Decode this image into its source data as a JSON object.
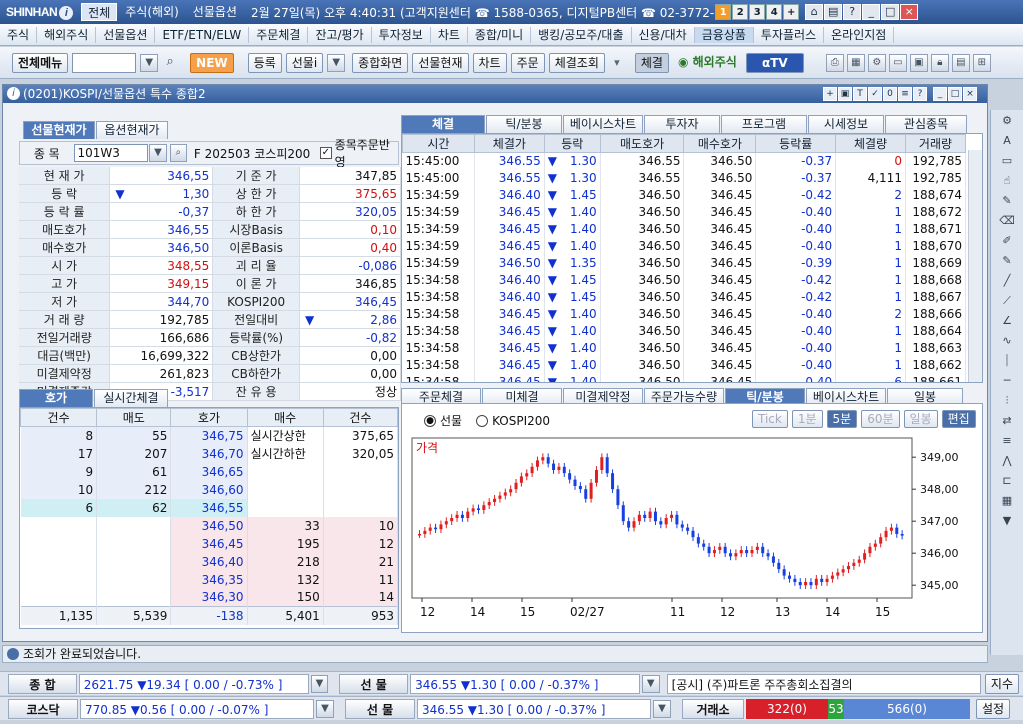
{
  "titlebar": {
    "logo": "SHINHAN",
    "tabs": [
      "전체",
      "주식(해외)",
      "선물옵션"
    ],
    "info": "2월 27일(목) 오후 4:40:31 (고객지원센터 ☎ 1588-0365, 디지털PB센터 ☎ 02-3772-",
    "nums": [
      "1",
      "2",
      "3",
      "4",
      "+"
    ]
  },
  "menu": [
    "주식",
    "해외주식",
    "선물옵션",
    "ETF/ETN/ELW",
    "주문체결",
    "잔고/평가",
    "투자정보",
    "차트",
    "종합/미니",
    "뱅킹/공모주/대출",
    "신용/대차",
    "금융상품",
    "투자플러스",
    "온라인지점"
  ],
  "toolbar": {
    "all_menu": "전체메뉴",
    "new": "NEW",
    "register": "등록",
    "futures_select": "선물i",
    "buttons": [
      "종합화면",
      "선물현재",
      "차트",
      "주문",
      "체결조회"
    ],
    "trade": "체결",
    "overseas": "해외주식",
    "tv": "TV"
  },
  "window": {
    "title": "(0201)KOSPI/선물옵션 특수 종합2",
    "title_btns": [
      "+",
      "□",
      "T",
      "?",
      "0",
      "≡",
      "?",
      "_",
      "□",
      "×"
    ]
  },
  "left_tabs": [
    "선물현재가",
    "옵션현재가"
  ],
  "symbol": {
    "label": "종  목",
    "code": "101W3",
    "name": "F 202503 코스피200",
    "checkbox": "종목주문반영"
  },
  "quote_rows": [
    {
      "l1": "현 재 가",
      "v1": "346,55",
      "c1": "blue",
      "l2": "기 준 가",
      "v2": "347,85",
      "c2": "blk"
    },
    {
      "l1": "등    락",
      "v1": "1,30",
      "c1": "blue",
      "arrow": "▼",
      "l2": "상 한 가",
      "v2": "375,65",
      "c2": "red"
    },
    {
      "l1": "등 락 률",
      "v1": "-0,37",
      "c1": "blue",
      "l2": "하 한 가",
      "v2": "320,05",
      "c2": "blue"
    },
    {
      "l1": "매도호가",
      "v1": "346,55",
      "c1": "blue",
      "l2": "시장Basis",
      "v2": "0,10",
      "c2": "red"
    },
    {
      "l1": "매수호가",
      "v1": "346,50",
      "c1": "blue",
      "l2": "이론Basis",
      "v2": "0,40",
      "c2": "red"
    },
    {
      "l1": "시    가",
      "v1": "348,55",
      "c1": "red",
      "l2": "괴 리 율",
      "v2": "-0,086",
      "c2": "blue"
    },
    {
      "l1": "고    가",
      "v1": "349,15",
      "c1": "red",
      "l2": "이 론 가",
      "v2": "346,85",
      "c2": "blk"
    },
    {
      "l1": "저    가",
      "v1": "344,70",
      "c1": "blue",
      "l2": "KOSPI200",
      "v2": "346,45",
      "c2": "blue"
    },
    {
      "l1": "거 래 량",
      "v1": "192,785",
      "c1": "blk",
      "l2": "전일대비",
      "v2": "2,86",
      "c2": "blue",
      "arrow2": "▼"
    },
    {
      "l1": "전일거래량",
      "v1": "166,686",
      "c1": "blk",
      "l2": "등락률(%)",
      "v2": "-0,82",
      "c2": "blue"
    },
    {
      "l1": "대금(백만)",
      "v1": "16,699,322",
      "c1": "blk",
      "l2": "CB상한가",
      "v2": "0,00",
      "c2": "blk"
    },
    {
      "l1": "미결제약정",
      "v1": "261,823",
      "c1": "blk",
      "l2": "CB하한가",
      "v2": "0,00",
      "c2": "blk"
    },
    {
      "l1": "미결제증감",
      "v1": "-3,517",
      "c1": "blue",
      "l2": "잔 유 용",
      "v2": "정상",
      "c2": "blk"
    }
  ],
  "trade_tabs": [
    "체결",
    "틱/분봉",
    "베이시스차트",
    "투자자",
    "프로그램",
    "시세정보",
    "관심종목"
  ],
  "trade_header": [
    "시간",
    "체결가",
    "등락",
    "매도호가",
    "매수호가",
    "등락률",
    "체결량",
    "거래량"
  ],
  "trades": [
    [
      "15:45:00",
      "346.55",
      "1.30",
      "346.55",
      "346.50",
      "-0.37",
      "0",
      "192,785"
    ],
    [
      "15:45:00",
      "346.55",
      "1.30",
      "346.55",
      "346.50",
      "-0.37",
      "4,111",
      "192,785"
    ],
    [
      "15:34:59",
      "346.40",
      "1.45",
      "346.50",
      "346.45",
      "-0.42",
      "2",
      "188,674"
    ],
    [
      "15:34:59",
      "346.45",
      "1.40",
      "346.50",
      "346.45",
      "-0.40",
      "1",
      "188,672"
    ],
    [
      "15:34:59",
      "346.45",
      "1.40",
      "346.50",
      "346.45",
      "-0.40",
      "1",
      "188,671"
    ],
    [
      "15:34:59",
      "346.45",
      "1.40",
      "346.50",
      "346.45",
      "-0.40",
      "1",
      "188,670"
    ],
    [
      "15:34:59",
      "346.50",
      "1.35",
      "346.50",
      "346.45",
      "-0.39",
      "1",
      "188,669"
    ],
    [
      "15:34:58",
      "346.40",
      "1.45",
      "346.50",
      "346.45",
      "-0.42",
      "1",
      "188,668"
    ],
    [
      "15:34:58",
      "346.40",
      "1.45",
      "346.50",
      "346.45",
      "-0.42",
      "1",
      "188,667"
    ],
    [
      "15:34:58",
      "346.45",
      "1.40",
      "346.50",
      "346.45",
      "-0.40",
      "2",
      "188,666"
    ],
    [
      "15:34:58",
      "346.45",
      "1.40",
      "346.50",
      "346.45",
      "-0.40",
      "1",
      "188,664"
    ],
    [
      "15:34:58",
      "346.45",
      "1.40",
      "346.50",
      "346.45",
      "-0.40",
      "1",
      "188,663"
    ],
    [
      "15:34:58",
      "346.45",
      "1.40",
      "346.50",
      "346.45",
      "-0.40",
      "1",
      "188,662"
    ],
    [
      "15:34:58",
      "346.45",
      "1.40",
      "346.50",
      "346.45",
      "-0.40",
      "6",
      "188,661"
    ]
  ],
  "ob_tabs": [
    "호가",
    "실시간체결"
  ],
  "ob_header": [
    "건수",
    "매도",
    "호가",
    "매수",
    "건수"
  ],
  "ob_asks": [
    [
      "8",
      "55",
      "346,75"
    ],
    [
      "17",
      "207",
      "346,70"
    ],
    [
      "9",
      "61",
      "346,65"
    ],
    [
      "10",
      "212",
      "346,60"
    ],
    [
      "6",
      "62",
      "346,55"
    ]
  ],
  "ob_bids": [
    [
      "346,50",
      "33",
      "10"
    ],
    [
      "346,45",
      "195",
      "12"
    ],
    [
      "346,40",
      "218",
      "21"
    ],
    [
      "346,35",
      "132",
      "11"
    ],
    [
      "346,30",
      "150",
      "14"
    ]
  ],
  "ob_side": [
    [
      "실시간상한",
      "375,65"
    ],
    [
      "실시간하한",
      "320,05"
    ]
  ],
  "ob_total": [
    "1,135",
    "5,539",
    "-138",
    "5,401",
    "953"
  ],
  "chart_tabs": [
    "주문체결",
    "미체결",
    "미결제약정",
    "주문가능수량",
    "틱/분봉",
    "베이시스차트",
    "일봉"
  ],
  "chart_opts": {
    "radio1": "선물",
    "radio2": "KOSPI200",
    "btns": [
      "Tick",
      "1분",
      "5분",
      "60분",
      "일봉",
      "편집"
    ]
  },
  "chart_data": {
    "type": "candlestick",
    "title": "가격",
    "y_ticks": [
      "349,00",
      "348,00",
      "347,00",
      "346,00",
      "345,00"
    ],
    "ylim": [
      344.6,
      349.6
    ],
    "x_labels": [
      "12",
      "14",
      "15",
      "02/27",
      "11",
      "12",
      "13",
      "14",
      "15"
    ],
    "closes": [
      346.6,
      346.7,
      346.8,
      346.75,
      346.9,
      347.0,
      347.1,
      347.2,
      347.1,
      347.3,
      347.4,
      347.35,
      347.5,
      347.6,
      347.7,
      347.8,
      347.9,
      348.0,
      348.2,
      348.4,
      348.5,
      348.7,
      348.9,
      349.0,
      348.8,
      348.6,
      348.7,
      348.5,
      348.3,
      348.1,
      348.0,
      347.7,
      348.2,
      348.6,
      349.0,
      348.5,
      348.0,
      347.5,
      347.0,
      346.8,
      347.0,
      347.2,
      347.1,
      347.3,
      347.0,
      346.9,
      347.1,
      347.2,
      346.9,
      346.8,
      346.7,
      346.5,
      346.3,
      346.2,
      346.0,
      346.1,
      346.2,
      346.0,
      345.9,
      346.0,
      346.1,
      346.0,
      346.1,
      346.2,
      346.0,
      345.9,
      345.7,
      345.5,
      345.3,
      345.2,
      345.1,
      345.0,
      345.1,
      345.0,
      345.2,
      345.1,
      345.2,
      345.3,
      345.4,
      345.5,
      345.6,
      345.7,
      345.8,
      346.0,
      346.2,
      346.3,
      346.5,
      346.7,
      346.8,
      346.6,
      346.55
    ]
  },
  "status": "조회가 완료되었습니다.",
  "ticker1": {
    "l1": "종  합",
    "v1": "2621.75  ▼19.34  [ 0.00  /  -0.73% ]",
    "l2": "선  물",
    "v2": "346.55  ▼1.30  [ 0.00  /  -0.37% ]",
    "news": "[공시] (주)파트론 주주총회소집결의",
    "btn": "지수"
  },
  "ticker2": {
    "l1": "코스닥",
    "v1": "770.85  ▼0.56  [ 0.00  /  -0.07% ]",
    "l2": "선  물",
    "v2": "346.55  ▼1.30  [ 0.00  /  -0.37% ]",
    "l3": "거래소",
    "up": "322(0)",
    "flat": "53",
    "down": "566(0)",
    "btn": "설정"
  },
  "colors": {
    "up": "#d01010",
    "down": "#1030d0",
    "title": "#35609d"
  }
}
